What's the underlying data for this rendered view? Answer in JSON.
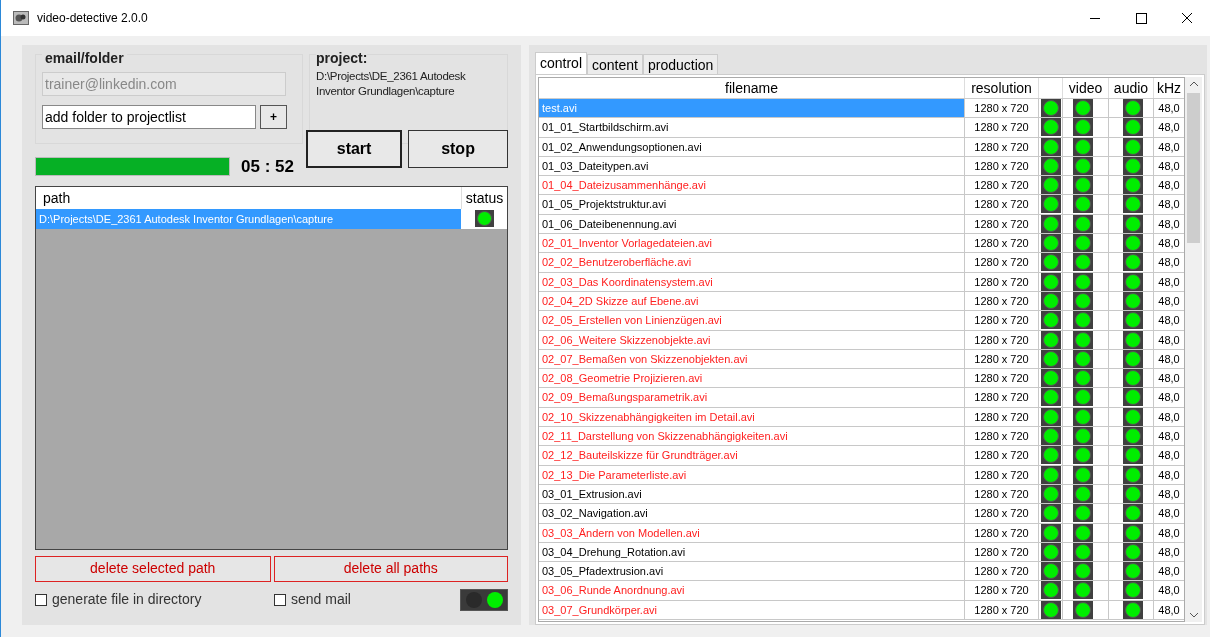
{
  "window": {
    "title": "video-detective 2.0.0"
  },
  "email_folder": {
    "heading": "email/folder",
    "email": "trainer@linkedin.com",
    "folder_field": "add folder to projectlist",
    "add_button": "+"
  },
  "project": {
    "heading": "project:",
    "path": "D:\\Projects\\DE_2361 Autodesk Inventor Grundlagen\\capture"
  },
  "progress": {
    "level": 1,
    "time": "05 : 52"
  },
  "buttons": {
    "start": "start",
    "stop": "stop",
    "delete_selected": "delete selected path",
    "delete_all": "delete all paths"
  },
  "paths": {
    "columns": [
      "path",
      "status"
    ],
    "rows": [
      {
        "path": "D:\\Projects\\DE_2361 Autodesk Inventor Grundlagen\\capture",
        "selected": true,
        "ok": true
      }
    ]
  },
  "options": [
    {
      "label": "generate file in directory",
      "checked": false
    },
    {
      "label": "send mail",
      "checked": false
    }
  ],
  "lamp": {
    "on": true
  },
  "tabs": [
    {
      "label": "control",
      "selected": true
    },
    {
      "label": "content",
      "selected": false
    },
    {
      "label": "production",
      "selected": false
    }
  ],
  "files": {
    "columns": [
      "filename",
      "resolution",
      "video",
      "audio",
      "kHz"
    ],
    "rows": [
      {
        "filename": "test.avi",
        "resolution": "1280 x 720",
        "khz": "48,0",
        "selected": true,
        "flagged": false,
        "ok": true
      },
      {
        "filename": "01_01_Startbildschirm.avi",
        "resolution": "1280 x 720",
        "khz": "48,0",
        "selected": false,
        "flagged": false,
        "ok": true
      },
      {
        "filename": "01_02_Anwendungsoptionen.avi",
        "resolution": "1280 x 720",
        "khz": "48,0",
        "selected": false,
        "flagged": false,
        "ok": true
      },
      {
        "filename": "01_03_Dateitypen.avi",
        "resolution": "1280 x 720",
        "khz": "48,0",
        "selected": false,
        "flagged": false,
        "ok": true
      },
      {
        "filename": "01_04_Dateizusammenhänge.avi",
        "resolution": "1280 x 720",
        "khz": "48,0",
        "selected": false,
        "flagged": true,
        "ok": true
      },
      {
        "filename": "01_05_Projektstruktur.avi",
        "resolution": "1280 x 720",
        "khz": "48,0",
        "selected": false,
        "flagged": false,
        "ok": true
      },
      {
        "filename": "01_06_Dateibenennung.avi",
        "resolution": "1280 x 720",
        "khz": "48,0",
        "selected": false,
        "flagged": false,
        "ok": true
      },
      {
        "filename": "02_01_Inventor Vorlagedateien.avi",
        "resolution": "1280 x 720",
        "khz": "48,0",
        "selected": false,
        "flagged": true,
        "ok": true
      },
      {
        "filename": "02_02_Benutzeroberfläche.avi",
        "resolution": "1280 x 720",
        "khz": "48,0",
        "selected": false,
        "flagged": true,
        "ok": true
      },
      {
        "filename": "02_03_Das Koordinatensystem.avi",
        "resolution": "1280 x 720",
        "khz": "48,0",
        "selected": false,
        "flagged": true,
        "ok": true
      },
      {
        "filename": "02_04_2D Skizze auf Ebene.avi",
        "resolution": "1280 x 720",
        "khz": "48,0",
        "selected": false,
        "flagged": true,
        "ok": true
      },
      {
        "filename": "02_05_Erstellen von Linienzügen.avi",
        "resolution": "1280 x 720",
        "khz": "48,0",
        "selected": false,
        "flagged": true,
        "ok": true
      },
      {
        "filename": "02_06_Weitere Skizzenobjekte.avi",
        "resolution": "1280 x 720",
        "khz": "48,0",
        "selected": false,
        "flagged": true,
        "ok": true
      },
      {
        "filename": "02_07_Bemaßen von Skizzenobjekten.avi",
        "resolution": "1280 x 720",
        "khz": "48,0",
        "selected": false,
        "flagged": true,
        "ok": true
      },
      {
        "filename": "02_08_Geometrie Projizieren.avi",
        "resolution": "1280 x 720",
        "khz": "48,0",
        "selected": false,
        "flagged": true,
        "ok": true
      },
      {
        "filename": "02_09_Bemaßungsparametrik.avi",
        "resolution": "1280 x 720",
        "khz": "48,0",
        "selected": false,
        "flagged": true,
        "ok": true
      },
      {
        "filename": "02_10_Skizzenabhängigkeiten im Detail.avi",
        "resolution": "1280 x 720",
        "khz": "48,0",
        "selected": false,
        "flagged": true,
        "ok": true
      },
      {
        "filename": "02_11_Darstellung von Skizzenabhängigkeiten.avi",
        "resolution": "1280 x 720",
        "khz": "48,0",
        "selected": false,
        "flagged": true,
        "ok": true
      },
      {
        "filename": "02_12_Bauteilskizze für Grundträger.avi",
        "resolution": "1280 x 720",
        "khz": "48,0",
        "selected": false,
        "flagged": true,
        "ok": true
      },
      {
        "filename": "02_13_Die Parameterliste.avi",
        "resolution": "1280 x 720",
        "khz": "48,0",
        "selected": false,
        "flagged": true,
        "ok": true
      },
      {
        "filename": "03_01_Extrusion.avi",
        "resolution": "1280 x 720",
        "khz": "48,0",
        "selected": false,
        "flagged": false,
        "ok": true
      },
      {
        "filename": "03_02_Navigation.avi",
        "resolution": "1280 x 720",
        "khz": "48,0",
        "selected": false,
        "flagged": false,
        "ok": true
      },
      {
        "filename": "03_03_Ändern von Modellen.avi",
        "resolution": "1280 x 720",
        "khz": "48,0",
        "selected": false,
        "flagged": true,
        "ok": true
      },
      {
        "filename": "03_04_Drehung_Rotation.avi",
        "resolution": "1280 x 720",
        "khz": "48,0",
        "selected": false,
        "flagged": false,
        "ok": true
      },
      {
        "filename": "03_05_Pfadextrusion.avi",
        "resolution": "1280 x 720",
        "khz": "48,0",
        "selected": false,
        "flagged": false,
        "ok": true
      },
      {
        "filename": "03_06_Runde Anordnung.avi",
        "resolution": "1280 x 720",
        "khz": "48,0",
        "selected": false,
        "flagged": true,
        "ok": true
      },
      {
        "filename": "03_07_Grundkörper.avi",
        "resolution": "1280 x 720",
        "khz": "48,0",
        "selected": false,
        "flagged": true,
        "ok": true
      }
    ]
  }
}
